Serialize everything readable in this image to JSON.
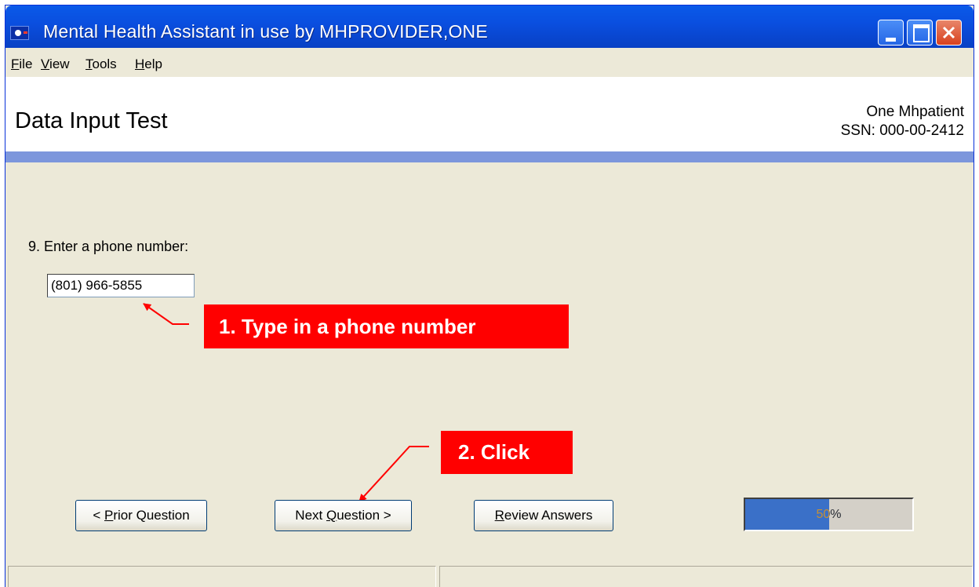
{
  "window": {
    "title": "Mental Health Assistant in use by MHPROVIDER,ONE"
  },
  "menu": [
    {
      "mnemonic": "F",
      "rest": "ile"
    },
    {
      "mnemonic": "V",
      "rest": "iew"
    },
    {
      "mnemonic": "T",
      "rest": "ools"
    },
    {
      "mnemonic": "H",
      "rest": "elp"
    }
  ],
  "header": {
    "title": "Data Input Test",
    "patient_name": "One Mhpatient",
    "patient_ssn": "SSN: 000-00-2412"
  },
  "question": {
    "label": "9. Enter a phone number:",
    "value": "(801) 966-5855"
  },
  "annotations": {
    "step1": "1. Type in a phone number",
    "step2": "2. Click"
  },
  "buttons": {
    "prior": {
      "pre": "< ",
      "mnemonic": "P",
      "post": "rior Question"
    },
    "next": {
      "pre": "Next ",
      "mnemonic": "Q",
      "post": "uestion >"
    },
    "review": {
      "pre": "",
      "mnemonic": "R",
      "post": "eview Answers"
    }
  },
  "progress": {
    "percent": 50,
    "label": "50%"
  },
  "status": {
    "left": "",
    "right": ""
  },
  "colors": {
    "callout": "#ff0000",
    "progress_fill": "#3a70c8",
    "header_band": "#7c96dc"
  }
}
